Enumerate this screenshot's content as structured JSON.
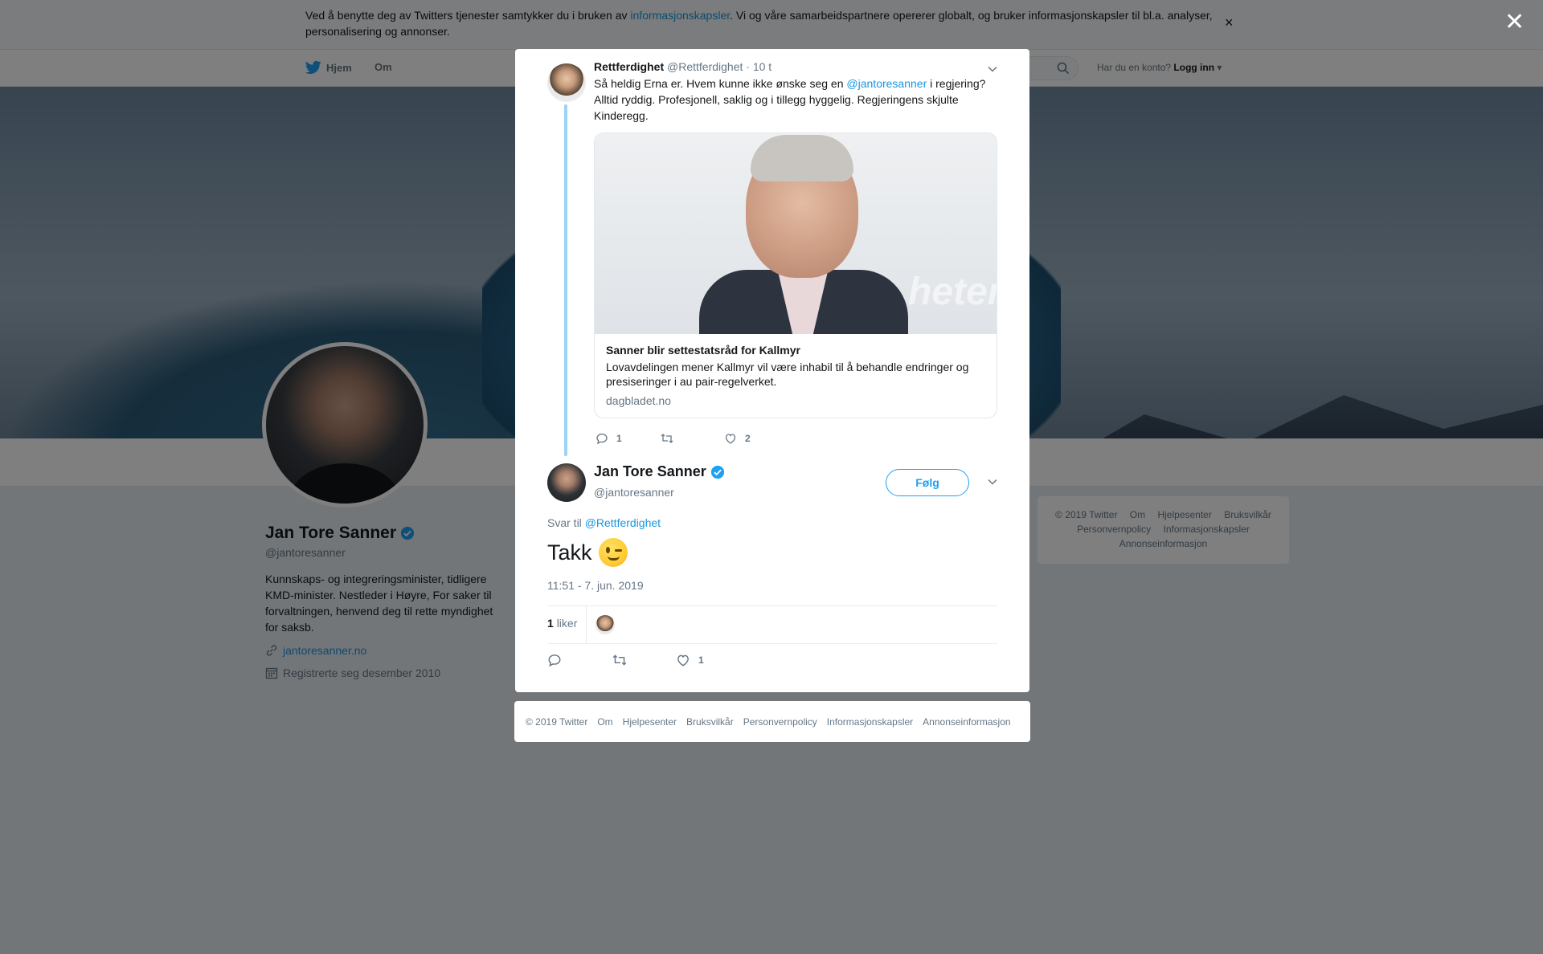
{
  "cookie_banner": {
    "text_before": "Ved å benytte deg av Twitters tjenester samtykker du i bruken av ",
    "link": "informasjonskapsler",
    "text_after": ". Vi og våre samarbeidspartnere opererer globalt, og bruker informasjonskapsler til bl.a. analyser, personalisering og annonser.",
    "close": "×"
  },
  "nav": {
    "home": "Hjem",
    "about": "Om",
    "account_prompt": "Har du en konto?",
    "login": "Logg inn"
  },
  "profile": {
    "name": "Jan Tore Sanner",
    "handle": "@jantoresanner",
    "bio": "Kunnskaps- og integreringsminister, tidligere KMD-minister. Nestleder i Høyre, For saker til forvaltningen, henvend deg til rette myndighet for saksb.",
    "website": "jantoresanner.no",
    "joined": "Registrerte seg desember 2010"
  },
  "sidebar_footer": {
    "items": [
      "© 2019 Twitter",
      "Om",
      "Hjelpesenter",
      "Bruksvilkår",
      "Personvernpolicy",
      "Informasjonskapsler",
      "Annonseinformasjon"
    ]
  },
  "overlay": {
    "close": "✕"
  },
  "parent_tweet": {
    "author_name": "Rettferdighet",
    "author_handle": "@Rettferdighet",
    "time": "· 10 t",
    "text_before": "Så heldig Erna er. Hvem kunne ikke ønske seg en ",
    "mention": "@jantoresanner",
    "text_after": " i regjering? Alltid ryddig. Profesjonell, saklig og i tillegg hyggelig. Regjeringens skjulte Kinderegg.",
    "card": {
      "title": "Sanner blir settestatsråd for Kallmyr",
      "description": "Lovavdelingen mener Kallmyr vil være inhabil til å behandle endringer og presiseringer i au pair-regelverket.",
      "domain": "dagbladet.no",
      "watermark": "heter"
    },
    "replies": "1",
    "retweets": "",
    "likes": "2"
  },
  "main_tweet": {
    "author_name": "Jan Tore Sanner",
    "author_handle": "@jantoresanner",
    "follow_label": "Følg",
    "reply_prefix": "Svar til ",
    "reply_to": "@Rettferdighet",
    "text": "Takk",
    "timestamp": "11:51 - 7. jun. 2019",
    "like_count": "1",
    "like_label": "liker",
    "action_likes": "1"
  },
  "modal_footer": {
    "items": [
      "© 2019 Twitter",
      "Om",
      "Hjelpesenter",
      "Bruksvilkår",
      "Personvernpolicy",
      "Informasjonskapsler",
      "Annonseinformasjon"
    ]
  },
  "colors": {
    "accent": "#1da1f2",
    "link": "#1b95e0",
    "thread_line": "#9ad4f6",
    "verified": "#1da1f2"
  },
  "icons": [
    "twitter-bird-icon",
    "search-icon",
    "caret-down-icon",
    "verified-icon",
    "link-icon",
    "calendar-icon",
    "reply-icon",
    "retweet-icon",
    "heart-icon",
    "close-icon",
    "chevron-down-icon"
  ]
}
